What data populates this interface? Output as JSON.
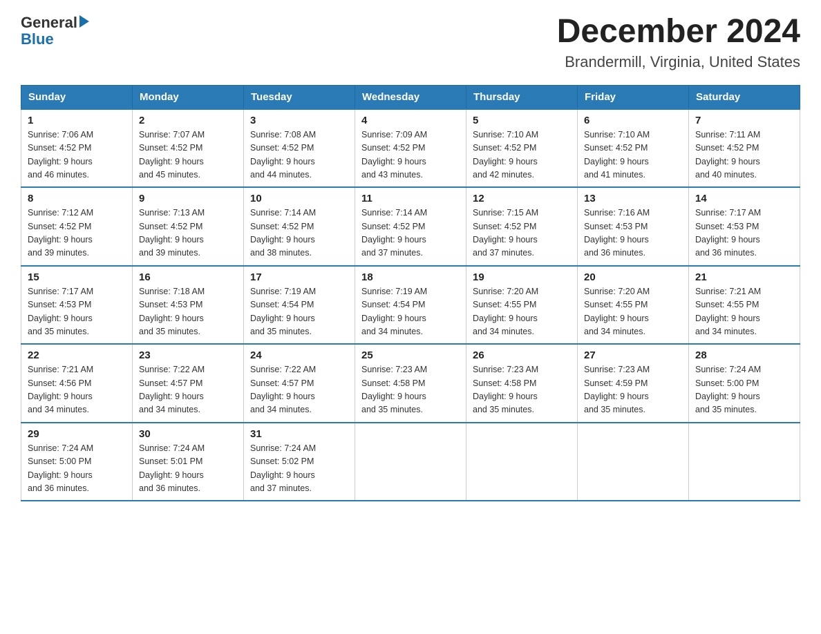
{
  "header": {
    "title": "December 2024",
    "subtitle": "Brandermill, Virginia, United States",
    "logo_general": "General",
    "logo_blue": "Blue"
  },
  "columns": [
    "Sunday",
    "Monday",
    "Tuesday",
    "Wednesday",
    "Thursday",
    "Friday",
    "Saturday"
  ],
  "weeks": [
    [
      {
        "day": "1",
        "sunrise": "7:06 AM",
        "sunset": "4:52 PM",
        "daylight": "9 hours and 46 minutes."
      },
      {
        "day": "2",
        "sunrise": "7:07 AM",
        "sunset": "4:52 PM",
        "daylight": "9 hours and 45 minutes."
      },
      {
        "day": "3",
        "sunrise": "7:08 AM",
        "sunset": "4:52 PM",
        "daylight": "9 hours and 44 minutes."
      },
      {
        "day": "4",
        "sunrise": "7:09 AM",
        "sunset": "4:52 PM",
        "daylight": "9 hours and 43 minutes."
      },
      {
        "day": "5",
        "sunrise": "7:10 AM",
        "sunset": "4:52 PM",
        "daylight": "9 hours and 42 minutes."
      },
      {
        "day": "6",
        "sunrise": "7:10 AM",
        "sunset": "4:52 PM",
        "daylight": "9 hours and 41 minutes."
      },
      {
        "day": "7",
        "sunrise": "7:11 AM",
        "sunset": "4:52 PM",
        "daylight": "9 hours and 40 minutes."
      }
    ],
    [
      {
        "day": "8",
        "sunrise": "7:12 AM",
        "sunset": "4:52 PM",
        "daylight": "9 hours and 39 minutes."
      },
      {
        "day": "9",
        "sunrise": "7:13 AM",
        "sunset": "4:52 PM",
        "daylight": "9 hours and 39 minutes."
      },
      {
        "day": "10",
        "sunrise": "7:14 AM",
        "sunset": "4:52 PM",
        "daylight": "9 hours and 38 minutes."
      },
      {
        "day": "11",
        "sunrise": "7:14 AM",
        "sunset": "4:52 PM",
        "daylight": "9 hours and 37 minutes."
      },
      {
        "day": "12",
        "sunrise": "7:15 AM",
        "sunset": "4:52 PM",
        "daylight": "9 hours and 37 minutes."
      },
      {
        "day": "13",
        "sunrise": "7:16 AM",
        "sunset": "4:53 PM",
        "daylight": "9 hours and 36 minutes."
      },
      {
        "day": "14",
        "sunrise": "7:17 AM",
        "sunset": "4:53 PM",
        "daylight": "9 hours and 36 minutes."
      }
    ],
    [
      {
        "day": "15",
        "sunrise": "7:17 AM",
        "sunset": "4:53 PM",
        "daylight": "9 hours and 35 minutes."
      },
      {
        "day": "16",
        "sunrise": "7:18 AM",
        "sunset": "4:53 PM",
        "daylight": "9 hours and 35 minutes."
      },
      {
        "day": "17",
        "sunrise": "7:19 AM",
        "sunset": "4:54 PM",
        "daylight": "9 hours and 35 minutes."
      },
      {
        "day": "18",
        "sunrise": "7:19 AM",
        "sunset": "4:54 PM",
        "daylight": "9 hours and 34 minutes."
      },
      {
        "day": "19",
        "sunrise": "7:20 AM",
        "sunset": "4:55 PM",
        "daylight": "9 hours and 34 minutes."
      },
      {
        "day": "20",
        "sunrise": "7:20 AM",
        "sunset": "4:55 PM",
        "daylight": "9 hours and 34 minutes."
      },
      {
        "day": "21",
        "sunrise": "7:21 AM",
        "sunset": "4:55 PM",
        "daylight": "9 hours and 34 minutes."
      }
    ],
    [
      {
        "day": "22",
        "sunrise": "7:21 AM",
        "sunset": "4:56 PM",
        "daylight": "9 hours and 34 minutes."
      },
      {
        "day": "23",
        "sunrise": "7:22 AM",
        "sunset": "4:57 PM",
        "daylight": "9 hours and 34 minutes."
      },
      {
        "day": "24",
        "sunrise": "7:22 AM",
        "sunset": "4:57 PM",
        "daylight": "9 hours and 34 minutes."
      },
      {
        "day": "25",
        "sunrise": "7:23 AM",
        "sunset": "4:58 PM",
        "daylight": "9 hours and 35 minutes."
      },
      {
        "day": "26",
        "sunrise": "7:23 AM",
        "sunset": "4:58 PM",
        "daylight": "9 hours and 35 minutes."
      },
      {
        "day": "27",
        "sunrise": "7:23 AM",
        "sunset": "4:59 PM",
        "daylight": "9 hours and 35 minutes."
      },
      {
        "day": "28",
        "sunrise": "7:24 AM",
        "sunset": "5:00 PM",
        "daylight": "9 hours and 35 minutes."
      }
    ],
    [
      {
        "day": "29",
        "sunrise": "7:24 AM",
        "sunset": "5:00 PM",
        "daylight": "9 hours and 36 minutes."
      },
      {
        "day": "30",
        "sunrise": "7:24 AM",
        "sunset": "5:01 PM",
        "daylight": "9 hours and 36 minutes."
      },
      {
        "day": "31",
        "sunrise": "7:24 AM",
        "sunset": "5:02 PM",
        "daylight": "9 hours and 37 minutes."
      },
      null,
      null,
      null,
      null
    ]
  ]
}
